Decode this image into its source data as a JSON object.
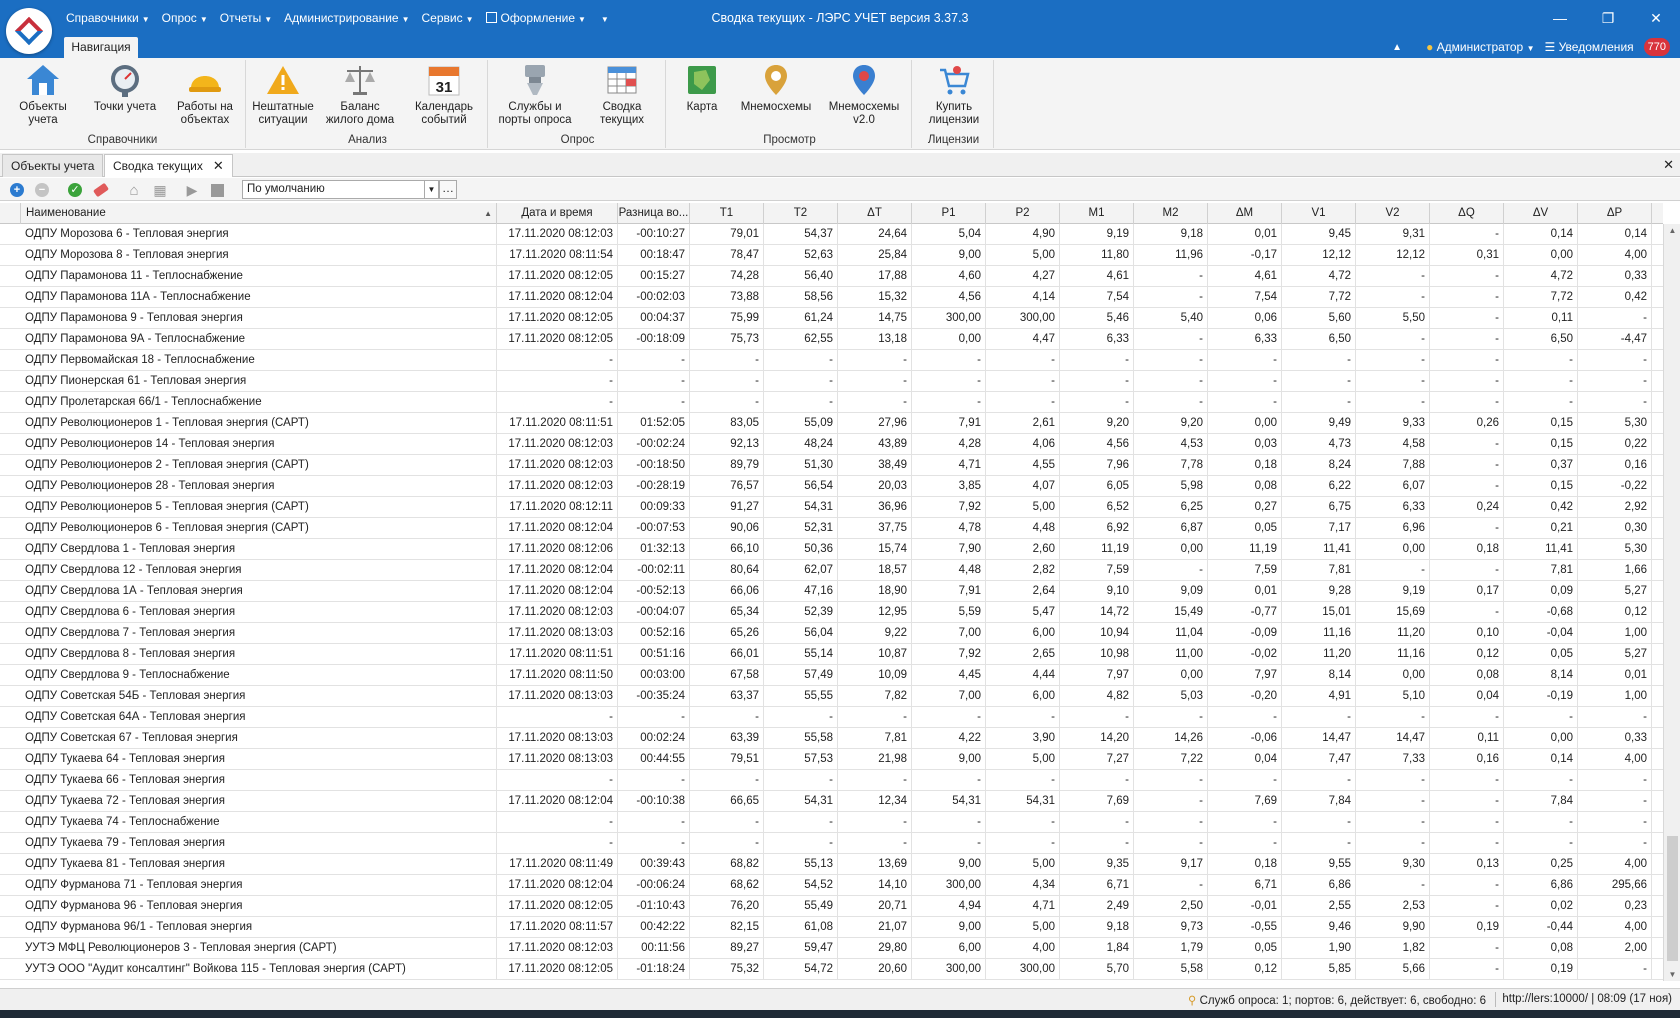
{
  "app": {
    "window_title": "Сводка текущих - ЛЭРС УЧЕТ версия 3.37.3",
    "menu": [
      "Справочники",
      "Опрос",
      "Отчеты",
      "Администрирование",
      "Сервис",
      "Оформление"
    ],
    "nav_tab": "Навигация",
    "user": "Администратор",
    "notifications_label": "Уведомления",
    "notifications_count": "770"
  },
  "ribbon": {
    "groups": [
      {
        "title": "Справочники",
        "buttons": [
          "Объекты учета",
          "Точки учета",
          "Работы на объектах"
        ]
      },
      {
        "title": "Анализ",
        "buttons": [
          "Нештатные ситуации",
          "Баланс жилого дома",
          "Календарь событий"
        ]
      },
      {
        "title": "Опрос",
        "buttons": [
          "Службы и порты опроса",
          "Сводка текущих"
        ]
      },
      {
        "title": "Просмотр",
        "buttons": [
          "Карта",
          "Мнемосхемы",
          "Мнемосхемы v2.0"
        ]
      },
      {
        "title": "Лицензии",
        "buttons": [
          "Купить лицензии"
        ]
      }
    ],
    "calendar_day": "31"
  },
  "doc_tabs": [
    "Объекты учета",
    "Сводка текущих"
  ],
  "toolbar": {
    "profile": "По умолчанию"
  },
  "colors": {
    "titlebar": "#1b6ec2",
    "badge": "#d8333b",
    "accent_red": "#c82f3c"
  },
  "table": {
    "columns": [
      "Наименование",
      "Дата и время",
      "Разница во...",
      "T1",
      "T2",
      "ΔT",
      "P1",
      "P2",
      "M1",
      "M2",
      "ΔM",
      "V1",
      "V2",
      "ΔQ",
      "ΔV",
      "ΔP"
    ],
    "rows": [
      [
        "ОДПУ Морозова 6 - Тепловая энергия",
        "17.11.2020 08:12:03",
        "-00:10:27",
        "79,01",
        "54,37",
        "24,64",
        "5,04",
        "4,90",
        "9,19",
        "9,18",
        "0,01",
        "9,45",
        "9,31",
        "-",
        "0,14",
        "0,14"
      ],
      [
        "ОДПУ Морозова 8 - Тепловая энергия",
        "17.11.2020 08:11:54",
        "00:18:47",
        "78,47",
        "52,63",
        "25,84",
        "9,00",
        "5,00",
        "11,80",
        "11,96",
        "-0,17",
        "12,12",
        "12,12",
        "0,31",
        "0,00",
        "4,00"
      ],
      [
        "ОДПУ Парамонова 11 - Теплоснабжение",
        "17.11.2020 08:12:05",
        "00:15:27",
        "74,28",
        "56,40",
        "17,88",
        "4,60",
        "4,27",
        "4,61",
        "-",
        "4,61",
        "4,72",
        "-",
        "-",
        "4,72",
        "0,33"
      ],
      [
        "ОДПУ Парамонова 11А - Теплоснабжение",
        "17.11.2020 08:12:04",
        "-00:02:03",
        "73,88",
        "58,56",
        "15,32",
        "4,56",
        "4,14",
        "7,54",
        "-",
        "7,54",
        "7,72",
        "-",
        "-",
        "7,72",
        "0,42"
      ],
      [
        "ОДПУ Парамонова 9 - Тепловая энергия",
        "17.11.2020 08:12:05",
        "00:04:37",
        "75,99",
        "61,24",
        "14,75",
        "300,00",
        "300,00",
        "5,46",
        "5,40",
        "0,06",
        "5,60",
        "5,50",
        "-",
        "0,11",
        "-"
      ],
      [
        "ОДПУ Парамонова 9А - Теплоснабжение",
        "17.11.2020 08:12:05",
        "-00:18:09",
        "75,73",
        "62,55",
        "13,18",
        "0,00",
        "4,47",
        "6,33",
        "-",
        "6,33",
        "6,50",
        "-",
        "-",
        "6,50",
        "-4,47"
      ],
      [
        "ОДПУ Первомайская 18 - Теплоснабжение",
        "-",
        "-",
        "-",
        "-",
        "-",
        "-",
        "-",
        "-",
        "-",
        "-",
        "-",
        "-",
        "-",
        "-",
        "-"
      ],
      [
        "ОДПУ Пионерская 61 - Тепловая энергия",
        "-",
        "-",
        "-",
        "-",
        "-",
        "-",
        "-",
        "-",
        "-",
        "-",
        "-",
        "-",
        "-",
        "-",
        "-"
      ],
      [
        "ОДПУ Пролетарская 66/1 - Теплоснабжение",
        "-",
        "-",
        "-",
        "-",
        "-",
        "-",
        "-",
        "-",
        "-",
        "-",
        "-",
        "-",
        "-",
        "-",
        "-"
      ],
      [
        "ОДПУ Революционеров 1 - Тепловая энергия (САРТ)",
        "17.11.2020 08:11:51",
        "01:52:05",
        "83,05",
        "55,09",
        "27,96",
        "7,91",
        "2,61",
        "9,20",
        "9,20",
        "0,00",
        "9,49",
        "9,33",
        "0,26",
        "0,15",
        "5,30"
      ],
      [
        "ОДПУ Революционеров 14 - Тепловая энергия",
        "17.11.2020 08:12:03",
        "-00:02:24",
        "92,13",
        "48,24",
        "43,89",
        "4,28",
        "4,06",
        "4,56",
        "4,53",
        "0,03",
        "4,73",
        "4,58",
        "-",
        "0,15",
        "0,22"
      ],
      [
        "ОДПУ Революционеров 2 - Тепловая энергия (САРТ)",
        "17.11.2020 08:12:03",
        "-00:18:50",
        "89,79",
        "51,30",
        "38,49",
        "4,71",
        "4,55",
        "7,96",
        "7,78",
        "0,18",
        "8,24",
        "7,88",
        "-",
        "0,37",
        "0,16"
      ],
      [
        "ОДПУ Революционеров 28 - Тепловая энергия",
        "17.11.2020 08:12:03",
        "-00:28:19",
        "76,57",
        "56,54",
        "20,03",
        "3,85",
        "4,07",
        "6,05",
        "5,98",
        "0,08",
        "6,22",
        "6,07",
        "-",
        "0,15",
        "-0,22"
      ],
      [
        "ОДПУ Революционеров 5 - Тепловая энергия (САРТ)",
        "17.11.2020 08:12:11",
        "00:09:33",
        "91,27",
        "54,31",
        "36,96",
        "7,92",
        "5,00",
        "6,52",
        "6,25",
        "0,27",
        "6,75",
        "6,33",
        "0,24",
        "0,42",
        "2,92"
      ],
      [
        "ОДПУ Революционеров 6 - Тепловая энергия (САРТ)",
        "17.11.2020 08:12:04",
        "-00:07:53",
        "90,06",
        "52,31",
        "37,75",
        "4,78",
        "4,48",
        "6,92",
        "6,87",
        "0,05",
        "7,17",
        "6,96",
        "-",
        "0,21",
        "0,30"
      ],
      [
        "ОДПУ Свердлова 1 - Тепловая энергия",
        "17.11.2020 08:12:06",
        "01:32:13",
        "66,10",
        "50,36",
        "15,74",
        "7,90",
        "2,60",
        "11,19",
        "0,00",
        "11,19",
        "11,41",
        "0,00",
        "0,18",
        "11,41",
        "5,30"
      ],
      [
        "ОДПУ Свердлова 12 - Тепловая энергия",
        "17.11.2020 08:12:04",
        "-00:02:11",
        "80,64",
        "62,07",
        "18,57",
        "4,48",
        "2,82",
        "7,59",
        "-",
        "7,59",
        "7,81",
        "-",
        "-",
        "7,81",
        "1,66"
      ],
      [
        "ОДПУ Свердлова 1А - Тепловая энергия",
        "17.11.2020 08:12:04",
        "-00:52:13",
        "66,06",
        "47,16",
        "18,90",
        "7,91",
        "2,64",
        "9,10",
        "9,09",
        "0,01",
        "9,28",
        "9,19",
        "0,17",
        "0,09",
        "5,27"
      ],
      [
        "ОДПУ Свердлова 6 - Тепловая энергия",
        "17.11.2020 08:12:03",
        "-00:04:07",
        "65,34",
        "52,39",
        "12,95",
        "5,59",
        "5,47",
        "14,72",
        "15,49",
        "-0,77",
        "15,01",
        "15,69",
        "-",
        "-0,68",
        "0,12"
      ],
      [
        "ОДПУ Свердлова 7 - Тепловая энергия",
        "17.11.2020 08:13:03",
        "00:52:16",
        "65,26",
        "56,04",
        "9,22",
        "7,00",
        "6,00",
        "10,94",
        "11,04",
        "-0,09",
        "11,16",
        "11,20",
        "0,10",
        "-0,04",
        "1,00"
      ],
      [
        "ОДПУ Свердлова 8 - Тепловая энергия",
        "17.11.2020 08:11:51",
        "00:51:16",
        "66,01",
        "55,14",
        "10,87",
        "7,92",
        "2,65",
        "10,98",
        "11,00",
        "-0,02",
        "11,20",
        "11,16",
        "0,12",
        "0,05",
        "5,27"
      ],
      [
        "ОДПУ Свердлова 9 - Теплоснабжение",
        "17.11.2020 08:11:50",
        "00:03:00",
        "67,58",
        "57,49",
        "10,09",
        "4,45",
        "4,44",
        "7,97",
        "0,00",
        "7,97",
        "8,14",
        "0,00",
        "0,08",
        "8,14",
        "0,01"
      ],
      [
        "ОДПУ Советская 54Б - Тепловая энергия",
        "17.11.2020 08:13:03",
        "-00:35:24",
        "63,37",
        "55,55",
        "7,82",
        "7,00",
        "6,00",
        "4,82",
        "5,03",
        "-0,20",
        "4,91",
        "5,10",
        "0,04",
        "-0,19",
        "1,00"
      ],
      [
        "ОДПУ Советская 64А - Тепловая энергия",
        "-",
        "-",
        "-",
        "-",
        "-",
        "-",
        "-",
        "-",
        "-",
        "-",
        "-",
        "-",
        "-",
        "-",
        "-"
      ],
      [
        "ОДПУ Советская 67 - Тепловая энергия",
        "17.11.2020 08:13:03",
        "00:02:24",
        "63,39",
        "55,58",
        "7,81",
        "4,22",
        "3,90",
        "14,20",
        "14,26",
        "-0,06",
        "14,47",
        "14,47",
        "0,11",
        "0,00",
        "0,33"
      ],
      [
        "ОДПУ Тукаева 64 - Тепловая энергия",
        "17.11.2020 08:13:03",
        "00:44:55",
        "79,51",
        "57,53",
        "21,98",
        "9,00",
        "5,00",
        "7,27",
        "7,22",
        "0,04",
        "7,47",
        "7,33",
        "0,16",
        "0,14",
        "4,00"
      ],
      [
        "ОДПУ Тукаева 66 - Тепловая энергия",
        "-",
        "-",
        "-",
        "-",
        "-",
        "-",
        "-",
        "-",
        "-",
        "-",
        "-",
        "-",
        "-",
        "-",
        "-"
      ],
      [
        "ОДПУ Тукаева 72 - Тепловая энергия",
        "17.11.2020 08:12:04",
        "-00:10:38",
        "66,65",
        "54,31",
        "12,34",
        "54,31",
        "54,31",
        "7,69",
        "-",
        "7,69",
        "7,84",
        "-",
        "-",
        "7,84",
        "-"
      ],
      [
        "ОДПУ Тукаева 74 - Теплоснабжение",
        "-",
        "-",
        "-",
        "-",
        "-",
        "-",
        "-",
        "-",
        "-",
        "-",
        "-",
        "-",
        "-",
        "-",
        "-"
      ],
      [
        "ОДПУ Тукаева 79 - Тепловая энергия",
        "-",
        "-",
        "-",
        "-",
        "-",
        "-",
        "-",
        "-",
        "-",
        "-",
        "-",
        "-",
        "-",
        "-",
        "-"
      ],
      [
        "ОДПУ Тукаева 81 - Тепловая энергия",
        "17.11.2020 08:11:49",
        "00:39:43",
        "68,82",
        "55,13",
        "13,69",
        "9,00",
        "5,00",
        "9,35",
        "9,17",
        "0,18",
        "9,55",
        "9,30",
        "0,13",
        "0,25",
        "4,00"
      ],
      [
        "ОДПУ Фурманова 71 - Тепловая энергия",
        "17.11.2020 08:12:04",
        "-00:06:24",
        "68,62",
        "54,52",
        "14,10",
        "300,00",
        "4,34",
        "6,71",
        "-",
        "6,71",
        "6,86",
        "-",
        "-",
        "6,86",
        "295,66"
      ],
      [
        "ОДПУ Фурманова 96 - Тепловая энергия",
        "17.11.2020 08:12:05",
        "-01:10:43",
        "76,20",
        "55,49",
        "20,71",
        "4,94",
        "4,71",
        "2,49",
        "2,50",
        "-0,01",
        "2,55",
        "2,53",
        "-",
        "0,02",
        "0,23"
      ],
      [
        "ОДПУ Фурманова 96/1 - Тепловая энергия",
        "17.11.2020 08:11:57",
        "00:42:22",
        "82,15",
        "61,08",
        "21,07",
        "9,00",
        "5,00",
        "9,18",
        "9,73",
        "-0,55",
        "9,46",
        "9,90",
        "0,19",
        "-0,44",
        "4,00"
      ],
      [
        "УУТЭ МФЦ Революционеров 3 - Тепловая энергия (САРТ)",
        "17.11.2020 08:12:03",
        "00:11:56",
        "89,27",
        "59,47",
        "29,80",
        "6,00",
        "4,00",
        "1,84",
        "1,79",
        "0,05",
        "1,90",
        "1,82",
        "-",
        "0,08",
        "2,00"
      ],
      [
        "УУТЭ ООО \"Аудит консалтинг\" Войкова 115 - Тепловая энергия (САРТ)",
        "17.11.2020 08:12:05",
        "-01:18:24",
        "75,32",
        "54,72",
        "20,60",
        "300,00",
        "300,00",
        "5,70",
        "5,58",
        "0,12",
        "5,85",
        "5,66",
        "-",
        "0,19",
        "-"
      ]
    ]
  },
  "status": {
    "polls": "Служб опроса: 1; портов: 6, действует: 6, свободно: 6",
    "url_time": "http://lers:10000/ | 08:09 (17 ноя)"
  }
}
